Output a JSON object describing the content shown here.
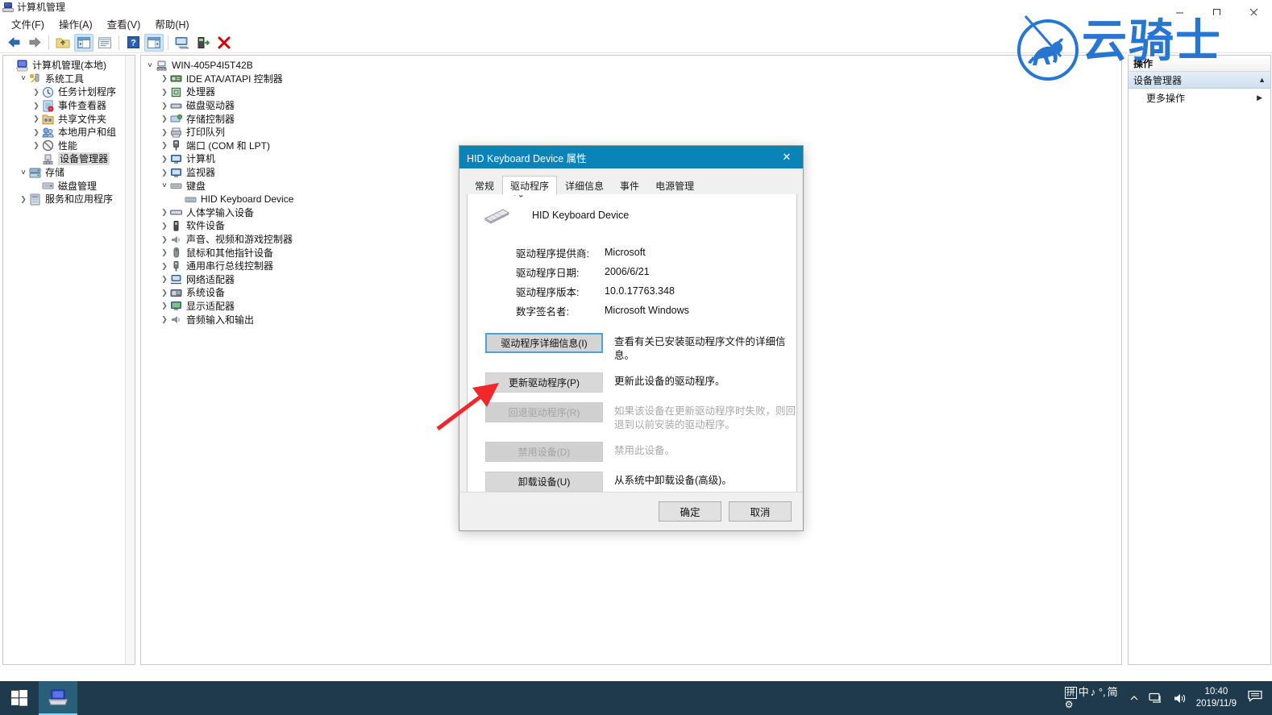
{
  "window": {
    "title": "计算机管理",
    "icon": "computer-management-icon",
    "minimize": "–",
    "maximize": "❐",
    "close": "✕"
  },
  "menubar": {
    "items": [
      {
        "label": "文件(F)"
      },
      {
        "label": "操作(A)"
      },
      {
        "label": "查看(V)"
      },
      {
        "label": "帮助(H)"
      }
    ]
  },
  "toolbar": {
    "buttons": [
      {
        "name": "back-icon"
      },
      {
        "name": "forward-icon"
      },
      {
        "name": "up-folder-icon"
      },
      {
        "name": "show-hide-console-tree-icon"
      },
      {
        "name": "properties-icon"
      },
      {
        "name": "help-icon"
      },
      {
        "name": "show-hide-action-pane-icon"
      },
      {
        "name": "scan-hardware-icon"
      },
      {
        "name": "update-driver-icon"
      },
      {
        "name": "uninstall-device-icon"
      }
    ]
  },
  "left_tree": {
    "nodes": [
      {
        "label": "计算机管理(本地)",
        "depth": 0,
        "twisty": "",
        "icon": "computer-management-icon",
        "selected": false
      },
      {
        "label": "系统工具",
        "depth": 1,
        "twisty": "open",
        "icon": "system-tools-icon",
        "selected": false
      },
      {
        "label": "任务计划程序",
        "depth": 2,
        "twisty": "closed",
        "icon": "task-scheduler-icon",
        "selected": false
      },
      {
        "label": "事件查看器",
        "depth": 2,
        "twisty": "closed",
        "icon": "event-viewer-icon",
        "selected": false
      },
      {
        "label": "共享文件夹",
        "depth": 2,
        "twisty": "closed",
        "icon": "shared-folders-icon",
        "selected": false
      },
      {
        "label": "本地用户和组",
        "depth": 2,
        "twisty": "closed",
        "icon": "local-users-groups-icon",
        "selected": false
      },
      {
        "label": "性能",
        "depth": 2,
        "twisty": "closed",
        "icon": "performance-icon",
        "selected": false
      },
      {
        "label": "设备管理器",
        "depth": 2,
        "twisty": "",
        "icon": "device-manager-icon",
        "selected": true
      },
      {
        "label": "存储",
        "depth": 1,
        "twisty": "open",
        "icon": "storage-icon",
        "selected": false
      },
      {
        "label": "磁盘管理",
        "depth": 2,
        "twisty": "",
        "icon": "disk-management-icon",
        "selected": false
      },
      {
        "label": "服务和应用程序",
        "depth": 1,
        "twisty": "closed",
        "icon": "services-applications-icon",
        "selected": false
      }
    ]
  },
  "center_tree": {
    "nodes": [
      {
        "label": "WIN-405P4I5T42B",
        "depth": 0,
        "twisty": "open",
        "icon": "computer-icon"
      },
      {
        "label": "IDE ATA/ATAPI 控制器",
        "depth": 1,
        "twisty": "closed",
        "icon": "ide-controller-icon"
      },
      {
        "label": "处理器",
        "depth": 1,
        "twisty": "closed",
        "icon": "processor-icon"
      },
      {
        "label": "磁盘驱动器",
        "depth": 1,
        "twisty": "closed",
        "icon": "disk-drive-icon"
      },
      {
        "label": "存储控制器",
        "depth": 1,
        "twisty": "closed",
        "icon": "storage-controller-icon"
      },
      {
        "label": "打印队列",
        "depth": 1,
        "twisty": "closed",
        "icon": "print-queue-icon"
      },
      {
        "label": "端口 (COM 和 LPT)",
        "depth": 1,
        "twisty": "closed",
        "icon": "ports-icon"
      },
      {
        "label": "计算机",
        "depth": 1,
        "twisty": "closed",
        "icon": "computer-node-icon"
      },
      {
        "label": "监视器",
        "depth": 1,
        "twisty": "closed",
        "icon": "monitor-icon"
      },
      {
        "label": "键盘",
        "depth": 1,
        "twisty": "open",
        "icon": "keyboard-icon"
      },
      {
        "label": "HID Keyboard Device",
        "depth": 2,
        "twisty": "",
        "icon": "keyboard-device-icon"
      },
      {
        "label": "人体学输入设备",
        "depth": 1,
        "twisty": "closed",
        "icon": "hid-icon"
      },
      {
        "label": "软件设备",
        "depth": 1,
        "twisty": "closed",
        "icon": "software-device-icon"
      },
      {
        "label": "声音、视频和游戏控制器",
        "depth": 1,
        "twisty": "closed",
        "icon": "sound-video-game-icon"
      },
      {
        "label": "鼠标和其他指针设备",
        "depth": 1,
        "twisty": "closed",
        "icon": "mouse-icon"
      },
      {
        "label": "通用串行总线控制器",
        "depth": 1,
        "twisty": "closed",
        "icon": "usb-controller-icon"
      },
      {
        "label": "网络适配器",
        "depth": 1,
        "twisty": "closed",
        "icon": "network-adapter-icon"
      },
      {
        "label": "系统设备",
        "depth": 1,
        "twisty": "closed",
        "icon": "system-device-icon"
      },
      {
        "label": "显示适配器",
        "depth": 1,
        "twisty": "closed",
        "icon": "display-adapter-icon"
      },
      {
        "label": "音频输入和输出",
        "depth": 1,
        "twisty": "closed",
        "icon": "audio-io-icon"
      }
    ]
  },
  "actions_pane": {
    "header": "操作",
    "group_label": "设备管理器",
    "group_collapse_icon": "▲",
    "items": [
      {
        "label": "更多操作",
        "submenu_icon": "▶"
      }
    ]
  },
  "watermark": {
    "text": "云骑士",
    "color": "#1b6fd0",
    "icon": "horse-rider-logo-icon"
  },
  "dialog": {
    "title": "HID Keyboard Device 属性",
    "close_label": "✕",
    "tabs": [
      {
        "label": "常规",
        "active": false
      },
      {
        "label": "驱动程序",
        "active": true
      },
      {
        "label": "详细信息",
        "active": false
      },
      {
        "label": "事件",
        "active": false
      },
      {
        "label": "电源管理",
        "active": false
      }
    ],
    "device_name": "HID Keyboard Device",
    "device_icon": "keyboard-device-icon",
    "info": [
      {
        "label": "驱动程序提供商:",
        "value": "Microsoft"
      },
      {
        "label": "驱动程序日期:",
        "value": "2006/6/21"
      },
      {
        "label": "驱动程序版本:",
        "value": "10.0.17763.348"
      },
      {
        "label": "数字签名者:",
        "value": "Microsoft Windows"
      }
    ],
    "action_buttons": [
      {
        "label": "驱动程序详细信息(I)",
        "desc": "查看有关已安装驱动程序文件的详细信息。",
        "disabled": false,
        "focused": true
      },
      {
        "label": "更新驱动程序(P)",
        "desc": "更新此设备的驱动程序。",
        "disabled": false,
        "focused": false
      },
      {
        "label": "回退驱动程序(R)",
        "desc": "如果该设备在更新驱动程序时失败，则回退到以前安装的驱动程序。",
        "disabled": true,
        "focused": false
      },
      {
        "label": "禁用设备(D)",
        "desc": "禁用此设备。",
        "disabled": true,
        "focused": false
      },
      {
        "label": "卸载设备(U)",
        "desc": "从系统中卸载设备(高级)。",
        "disabled": false,
        "focused": false
      }
    ],
    "footer": {
      "ok": "确定",
      "cancel": "取消"
    }
  },
  "annotation": {
    "arrow_color": "#f0282d",
    "arrow_target": "更新驱动程序(P)"
  },
  "taskbar": {
    "start_icon": "windows-start-icon",
    "running_app": "计算机管理",
    "tray": {
      "ime_mode": "拼",
      "ime_lang": "中",
      "ime_extra": "♪ °,",
      "ime_simplified": "简",
      "ime_settings_icon": "gear-icon",
      "chevron_icon": "^",
      "network_icon": "network-icon",
      "volume_icon": "volume-icon",
      "time": "10:40",
      "date": "2019/11/9",
      "notification_icon": "notification-icon"
    }
  }
}
